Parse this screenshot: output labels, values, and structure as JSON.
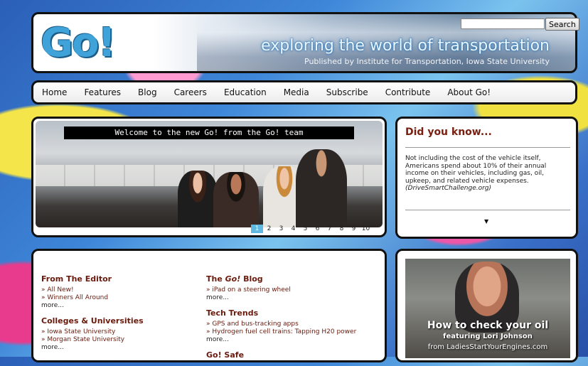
{
  "header": {
    "logo_text": "Go!",
    "tagline": "exploring the world of transportation",
    "publisher": "Published by Institute for Transportation, Iowa State University",
    "search_button": "Search",
    "search_value": ""
  },
  "nav": {
    "items": [
      "Home",
      "Features",
      "Blog",
      "Careers",
      "Education",
      "Media",
      "Subscribe",
      "Contribute",
      "About Go!"
    ]
  },
  "slideshow": {
    "caption": "Welcome to the new Go! from the Go! team",
    "pages": [
      "1",
      "2",
      "3",
      "4",
      "5",
      "6",
      "7",
      "8",
      "9",
      "10"
    ],
    "active_page": "1"
  },
  "did_you_know": {
    "title": "Did you know...",
    "text": "Not including the cost of the vehicle itself, Americans spend about 10% of their annual income on their vehicles, including gas, oil, upkeep, and related vehicle expenses.",
    "source": "(DriveSmartChallenge.org)"
  },
  "content": {
    "left": [
      {
        "heading": "From The Editor",
        "links": [
          "» All New!",
          "» Winners All Around"
        ],
        "more": "more..."
      },
      {
        "heading": "Colleges & Universities",
        "links": [
          "» Iowa State University",
          "» Morgan State University"
        ],
        "more": "more..."
      }
    ],
    "right": [
      {
        "heading_pre": "The ",
        "heading_em": "Go!",
        "heading_post": " Blog",
        "links": [
          "» iPad on a steering wheel"
        ],
        "more": "more..."
      },
      {
        "heading": "Tech Trends",
        "links": [
          "» GPS and bus-tracking apps",
          "» Hydrogen fuel cell trains: Tapping H20 power"
        ],
        "more": "more..."
      },
      {
        "heading": "Go! Safe"
      }
    ]
  },
  "video": {
    "title": "How to check your oil",
    "featuring": "featuring Lori Johnson",
    "source": "from LadiesStartYourEngines.com"
  }
}
